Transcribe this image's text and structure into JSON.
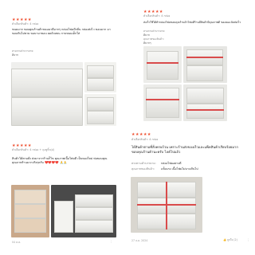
{
  "reviews": [
    {
      "stars": "★★★★★",
      "variation": "ตัวเลือกสินค้า: 4 กล่อง",
      "text": "ขนมมาก ขอบคุณร้านค้าขนมมาดีมากๆ กล่องโฟมมีกลิ่น กล่องส่งไว ขอบมาก มาขอบกันไม่ขาย ขอบามาขอบ ยดด้วยขน กาบขนมเด็กใส่",
      "label": "ตรงตามคำบรรยาย:",
      "label_value": "ดีมาก"
    },
    {
      "stars": "★★★★★",
      "variation": "ตัวเลือกสินค้า: 4 กล่อง",
      "text": "ส่งเร็วใช้ได้ทำกล่องโฟมขอบคุณร้านค้าโฟมดีร้านมีสินค้ามีคุณภาพดี ของเยอะจัดส่งเร็ว",
      "label1": "ตรงตามคำบรรยาย:",
      "label1_value": "ดีมาก",
      "label2": "คุณภาพของสินค้า:",
      "label2_value": "ดีมากๆ"
    },
    {
      "stars": "★★★★★",
      "variation": "ตัวเลือกสินค้า: 4 กล่อง + ถุงหูหิ้ว(ฝ)",
      "text": "สินค้าได้ตามสั่ง ส่งมาจากร้านก็ไข คุณภาพเนื้อโฟมดี เป็นของใหม่ ห่อขอบคุณคุณภาพร้านมากจริงๆครับ ❤️❤️❤️❤️ 🙏🙏",
      "date": "04 ต.ค."
    },
    {
      "stars": "★★★★★",
      "variation": "ตัวเลือกสินค้า: 4 กล่อง",
      "text": "ได้สินค้าตามที่สั่งครบถ้วน เพราะร้านส่งของเร็วและแพ็คสินค้าเรียบร้อยมาก ขอบคุณร้านค้านะครับ ไลค์ไปแล้ว",
      "label1": "ตรงตามคำบรรยาย:",
      "label1_value": "กล่องโฟมอย่างดี",
      "label2": "คุณภาพของสินค้า:",
      "label2_value": "แข็งแรง เนื้อโฟมไม่บางเกินไป",
      "date": "27 ธ.ค. 2024",
      "like": "ถูกใจ (2)"
    }
  ]
}
